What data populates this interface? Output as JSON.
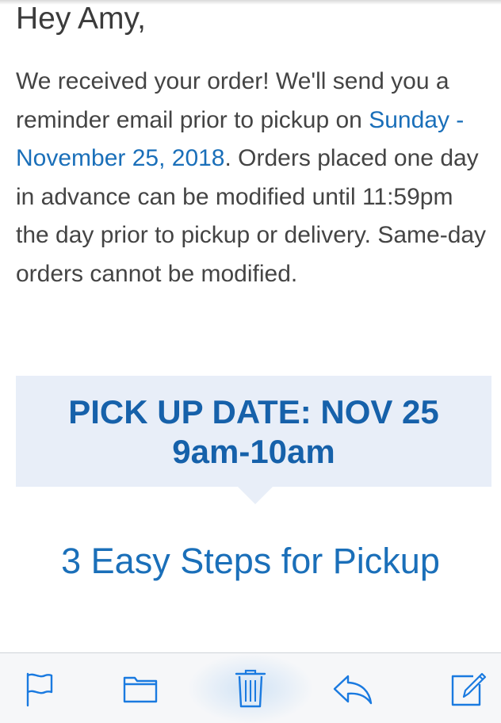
{
  "email": {
    "greeting": "Hey Amy,",
    "message_before_date": "We received your order! We'll send you a reminder email prior to pickup on ",
    "pickup_date_link": "Sunday - November 25, 2018",
    "message_after_date": ". Orders placed one day in advance can be modified until 11:59pm the day prior to pickup or delivery. Same-day orders cannot be modified.",
    "pickup_banner": {
      "line1": "PICK UP DATE: NOV 25",
      "line2": "9am-10am"
    },
    "steps_heading": "3 Easy Steps for Pickup"
  },
  "toolbar": {
    "buttons": [
      {
        "icon": "flag-icon",
        "action": "flag"
      },
      {
        "icon": "folder-icon",
        "action": "move"
      },
      {
        "icon": "trash-icon",
        "action": "delete"
      },
      {
        "icon": "reply-icon",
        "action": "reply"
      },
      {
        "icon": "compose-icon",
        "action": "compose"
      }
    ]
  },
  "colors": {
    "accent": "#1a6fb9",
    "banner_text": "#1661aa",
    "banner_bg": "#e8eef8",
    "body_text": "#444444"
  }
}
